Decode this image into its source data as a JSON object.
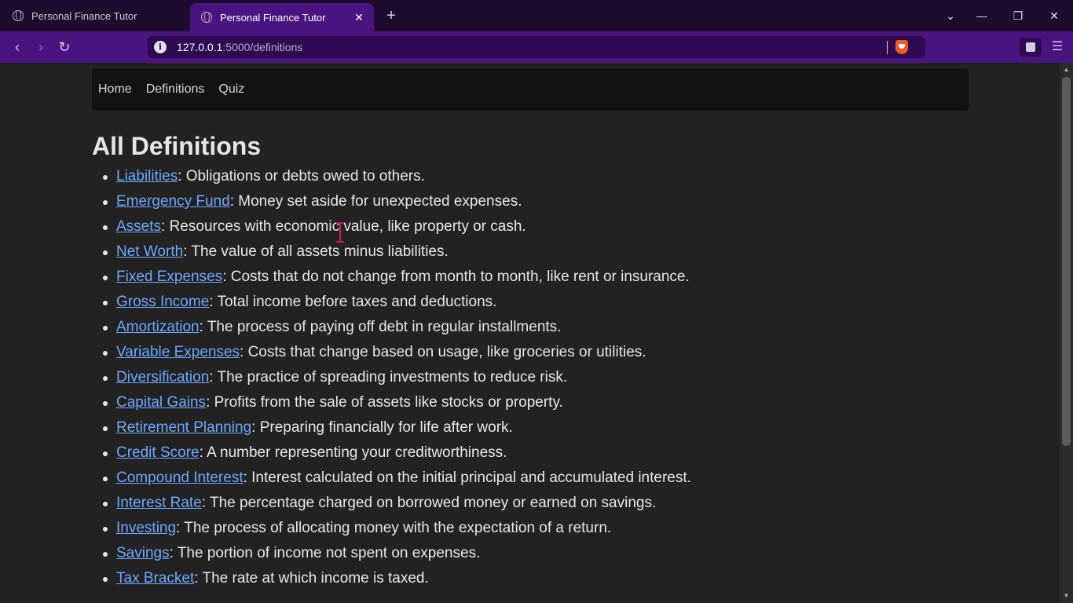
{
  "browser": {
    "tabs": [
      {
        "title": "Personal Finance Tutor",
        "active": false
      },
      {
        "title": "Personal Finance Tutor",
        "active": true
      }
    ],
    "url_host": "127.0.0.1",
    "url_rest": ":5000/definitions"
  },
  "nav": {
    "home": "Home",
    "definitions": "Definitions",
    "quiz": "Quiz"
  },
  "page": {
    "title": "All Definitions",
    "definitions": [
      {
        "term": "Liabilities",
        "desc": ": Obligations or debts owed to others."
      },
      {
        "term": "Emergency Fund",
        "desc": ": Money set aside for unexpected expenses."
      },
      {
        "term": "Assets",
        "desc": ": Resources with economic value, like property or cash."
      },
      {
        "term": "Net Worth",
        "desc": ": The value of all assets minus liabilities."
      },
      {
        "term": "Fixed Expenses",
        "desc": ": Costs that do not change from month to month, like rent or insurance."
      },
      {
        "term": "Gross Income",
        "desc": ": Total income before taxes and deductions."
      },
      {
        "term": "Amortization",
        "desc": ": The process of paying off debt in regular installments."
      },
      {
        "term": "Variable Expenses",
        "desc": ": Costs that change based on usage, like groceries or utilities."
      },
      {
        "term": "Diversification",
        "desc": ": The practice of spreading investments to reduce risk."
      },
      {
        "term": "Capital Gains",
        "desc": ": Profits from the sale of assets like stocks or property."
      },
      {
        "term": "Retirement Planning",
        "desc": ": Preparing financially for life after work."
      },
      {
        "term": "Credit Score",
        "desc": ": A number representing your creditworthiness."
      },
      {
        "term": "Compound Interest",
        "desc": ": Interest calculated on the initial principal and accumulated interest."
      },
      {
        "term": "Interest Rate",
        "desc": ": The percentage charged on borrowed money or earned on savings."
      },
      {
        "term": "Investing",
        "desc": ": The process of allocating money with the expectation of a return."
      },
      {
        "term": "Savings",
        "desc": ": The portion of income not spent on expenses."
      },
      {
        "term": "Tax Bracket",
        "desc": ": The rate at which income is taxed."
      }
    ]
  }
}
